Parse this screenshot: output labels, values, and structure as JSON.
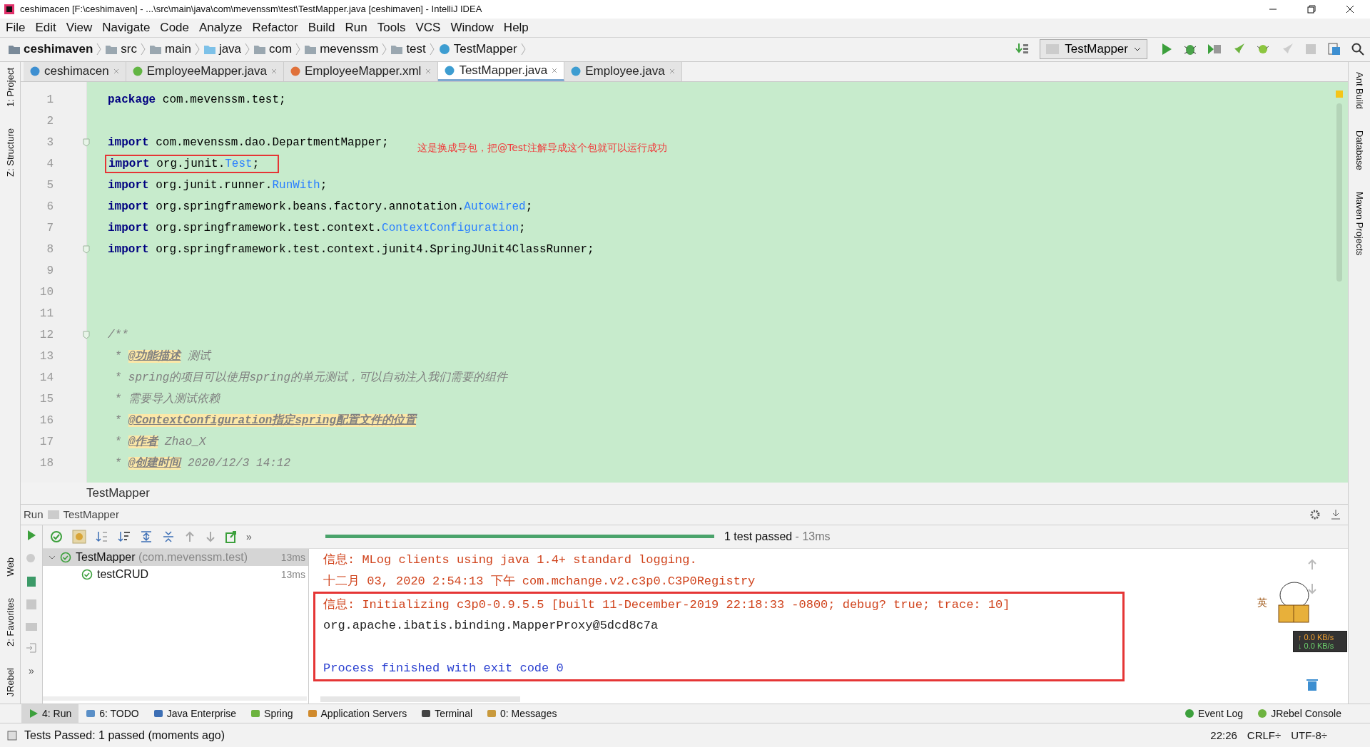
{
  "window": {
    "title": "ceshimacen [F:\\ceshimaven] - ...\\src\\main\\java\\com\\mevenssm\\test\\TestMapper.java [ceshimaven] - IntelliJ IDEA"
  },
  "menu": [
    "File",
    "Edit",
    "View",
    "Navigate",
    "Code",
    "Analyze",
    "Refactor",
    "Build",
    "Run",
    "Tools",
    "VCS",
    "Window",
    "Help"
  ],
  "breadcrumbs": [
    {
      "label": "ceshimaven",
      "kind": "project"
    },
    {
      "label": "src",
      "kind": "folder"
    },
    {
      "label": "main",
      "kind": "folder"
    },
    {
      "label": "java",
      "kind": "source"
    },
    {
      "label": "com",
      "kind": "package"
    },
    {
      "label": "mevenssm",
      "kind": "package"
    },
    {
      "label": "test",
      "kind": "package"
    },
    {
      "label": "TestMapper",
      "kind": "class"
    }
  ],
  "run_config": "TestMapper",
  "tabs": [
    {
      "label": "ceshimacen",
      "kind": "module",
      "selected": false
    },
    {
      "label": "EmployeeMapper.java",
      "kind": "interface",
      "selected": false
    },
    {
      "label": "EmployeeMapper.xml",
      "kind": "xml",
      "selected": false
    },
    {
      "label": "TestMapper.java",
      "kind": "class",
      "selected": true
    },
    {
      "label": "Employee.java",
      "kind": "class",
      "selected": false
    }
  ],
  "left_tool_tabs": [
    "1: Project",
    "Z: Structure"
  ],
  "left_tool_tabs_lower": [
    "Web",
    "2: Favorites",
    "JRebel"
  ],
  "right_tool_tabs": [
    "Ant Build",
    "Database",
    "Maven Projects"
  ],
  "editor": {
    "lines": [
      {
        "number": "1",
        "fold": false,
        "tokens": [
          {
            "kind": "keyword",
            "text": "package"
          },
          {
            "kind": "plain",
            "text": " com.mevenssm.test;"
          }
        ]
      },
      {
        "number": "2",
        "fold": false
      },
      {
        "number": "3",
        "fold": true,
        "tokens": [
          {
            "kind": "keyword",
            "text": "import"
          },
          {
            "kind": "plain",
            "text": " com.mevenssm.dao.DepartmentMapper;"
          }
        ]
      },
      {
        "number": "4",
        "fold": false,
        "boxed": true,
        "tokens": [
          {
            "kind": "keyword",
            "text": "import"
          },
          {
            "kind": "plain",
            "text": " org.junit."
          },
          {
            "kind": "ref",
            "text": "Test"
          },
          {
            "kind": "plain",
            "text": ";"
          }
        ]
      },
      {
        "number": "5",
        "fold": false,
        "tokens": [
          {
            "kind": "keyword",
            "text": "import"
          },
          {
            "kind": "plain",
            "text": " org.junit.runner."
          },
          {
            "kind": "ref",
            "text": "RunWith"
          },
          {
            "kind": "plain",
            "text": ";"
          }
        ]
      },
      {
        "number": "6",
        "fold": false,
        "tokens": [
          {
            "kind": "keyword",
            "text": "import"
          },
          {
            "kind": "plain",
            "text": " org.springframework.beans.factory.annotation."
          },
          {
            "kind": "ref",
            "text": "Autowired"
          },
          {
            "kind": "plain",
            "text": ";"
          }
        ]
      },
      {
        "number": "7",
        "fold": false,
        "tokens": [
          {
            "kind": "keyword",
            "text": "import"
          },
          {
            "kind": "plain",
            "text": " org.springframework.test.context."
          },
          {
            "kind": "ref",
            "text": "ContextConfiguration"
          },
          {
            "kind": "plain",
            "text": ";"
          }
        ]
      },
      {
        "number": "8",
        "fold": true,
        "tokens": [
          {
            "kind": "keyword",
            "text": "import"
          },
          {
            "kind": "plain",
            "text": " org.springframework.test.context.junit4.SpringJUnit4ClassRunner;"
          }
        ]
      },
      {
        "number": "9",
        "fold": false
      },
      {
        "number": "10",
        "fold": false
      },
      {
        "number": "11",
        "fold": false
      },
      {
        "number": "12",
        "fold": true,
        "tokens": [
          {
            "kind": "comment",
            "text": "/**"
          }
        ]
      },
      {
        "number": "13",
        "fold": false,
        "tokens": [
          {
            "kind": "comment",
            "text": " * "
          },
          {
            "kind": "tag",
            "text": "@功能描述"
          },
          {
            "kind": "comment",
            "text": " 测试"
          }
        ]
      },
      {
        "number": "14",
        "fold": false,
        "tokens": [
          {
            "kind": "comment",
            "text": " * spring的项目可以使用spring的单元测试，可以自动注入我们需要的组件"
          }
        ]
      },
      {
        "number": "15",
        "fold": false,
        "tokens": [
          {
            "kind": "comment",
            "text": " * 需要导入测试依赖"
          }
        ]
      },
      {
        "number": "16",
        "fold": false,
        "tokens": [
          {
            "kind": "comment",
            "text": " * "
          },
          {
            "kind": "tag",
            "text": "@ContextConfiguration指定spring配置文件的位置"
          }
        ]
      },
      {
        "number": "17",
        "fold": false,
        "tokens": [
          {
            "kind": "comment",
            "text": " * "
          },
          {
            "kind": "tag",
            "text": "@作者"
          },
          {
            "kind": "comment",
            "text": " Zhao_X"
          }
        ]
      },
      {
        "number": "18",
        "fold": false,
        "tokens": [
          {
            "kind": "comment",
            "text": " * "
          },
          {
            "kind": "tag",
            "text": "@创建时间"
          },
          {
            "kind": "comment",
            "text": " 2020/12/3 14:12"
          }
        ]
      }
    ],
    "note": "这是换成导包，把@Test注解导成这个包就可以运行成功",
    "breadcrumb": "TestMapper"
  },
  "run": {
    "label": "Run",
    "config": "TestMapper",
    "progress": {
      "level": 1
    },
    "result": "1 test passed",
    "duration": " - 13ms",
    "tree": [
      {
        "label": "TestMapper",
        "detail": " (com.mevenssm.test)",
        "time": "13ms",
        "selected": true,
        "children": [
          {
            "label": "testCRUD",
            "time": "13ms",
            "selected": false
          }
        ]
      }
    ],
    "side_more": "»",
    "toolbar_more": "»",
    "console": [
      {
        "kind": "info",
        "text": "信息: MLog clients using java 1.4+ standard logging."
      },
      {
        "kind": "info",
        "text": "十二月 03, 2020 2:54:13 下午 com.mchange.v2.c3p0.C3P0Registry"
      }
    ],
    "console_highlighted": [
      {
        "kind": "info",
        "text": "信息: Initializing c3p0-0.9.5.5 [built 11-December-2019 22:18:33 -0800; debug? true; trace: 10]"
      },
      {
        "kind": "plain",
        "text": "org.apache.ibatis.binding.MapperProxy@5dcd8c7a"
      },
      {
        "kind": "exit",
        "text": "Process finished with exit code 0"
      }
    ]
  },
  "widget": {
    "ime": "英",
    "upload": "↑ 0.0 KB/s",
    "download": "↓ 0.0 KB/s"
  },
  "bottom_tabs": [
    {
      "label": "4: Run",
      "kind": "run",
      "selected": true
    },
    {
      "label": "6: TODO",
      "kind": "todo",
      "selected": false
    },
    {
      "label": "Java Enterprise",
      "kind": "enterprise",
      "selected": false
    },
    {
      "label": "Spring",
      "kind": "spring",
      "selected": false
    },
    {
      "label": "Application Servers",
      "kind": "servers",
      "selected": false
    },
    {
      "label": "Terminal",
      "kind": "terminal",
      "selected": false
    },
    {
      "label": "0: Messages",
      "kind": "messages",
      "selected": false
    }
  ],
  "bottom_tabs_right": [
    {
      "label": "Event Log",
      "kind": "log"
    },
    {
      "label": "JRebel Console",
      "kind": "jrebel"
    }
  ],
  "status_bar": {
    "message": "Tests Passed: 1 passed (moments ago)",
    "position": "22:26",
    "line_separator": "CRLF÷",
    "encoding": "UTF-8÷"
  }
}
